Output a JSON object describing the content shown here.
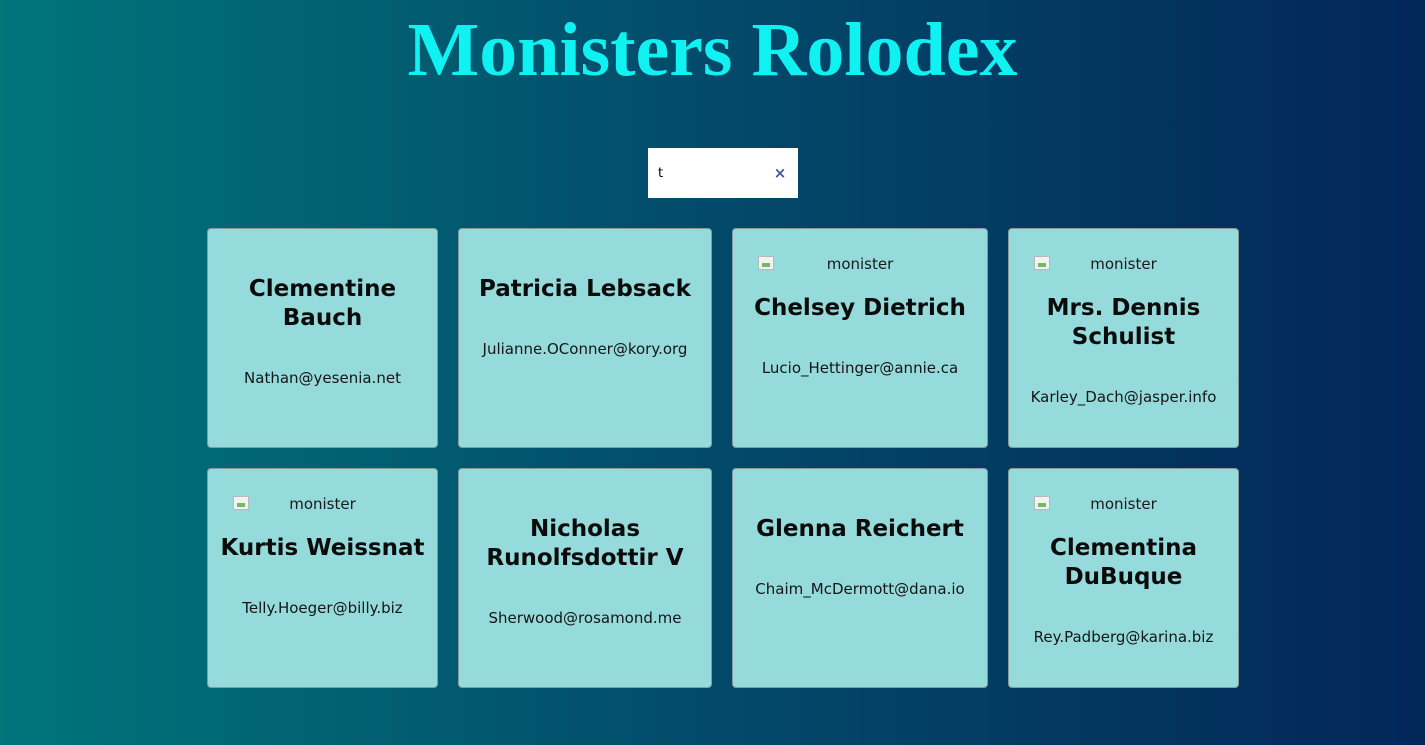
{
  "header": {
    "title": "Monisters Rolodex"
  },
  "search": {
    "value": "t",
    "clear_icon": "×"
  },
  "monster_image_alt": "monister",
  "cards": [
    {
      "name": "Clementine Bauch",
      "email": "Nathan@yesenia.net",
      "image_broken": false
    },
    {
      "name": "Patricia Lebsack",
      "email": "Julianne.OConner@kory.org",
      "image_broken": false
    },
    {
      "name": "Chelsey Dietrich",
      "email": "Lucio_Hettinger@annie.ca",
      "image_broken": true
    },
    {
      "name": "Mrs. Dennis Schulist",
      "email": "Karley_Dach@jasper.info",
      "image_broken": true
    },
    {
      "name": "Kurtis Weissnat",
      "email": "Telly.Hoeger@billy.biz",
      "image_broken": true
    },
    {
      "name": "Nicholas Runolfsdottir V",
      "email": "Sherwood@rosamond.me",
      "image_broken": false
    },
    {
      "name": "Glenna Reichert",
      "email": "Chaim_McDermott@dana.io",
      "image_broken": false
    },
    {
      "name": "Clementina DuBuque",
      "email": "Rey.Padberg@karina.biz",
      "image_broken": true
    }
  ]
}
